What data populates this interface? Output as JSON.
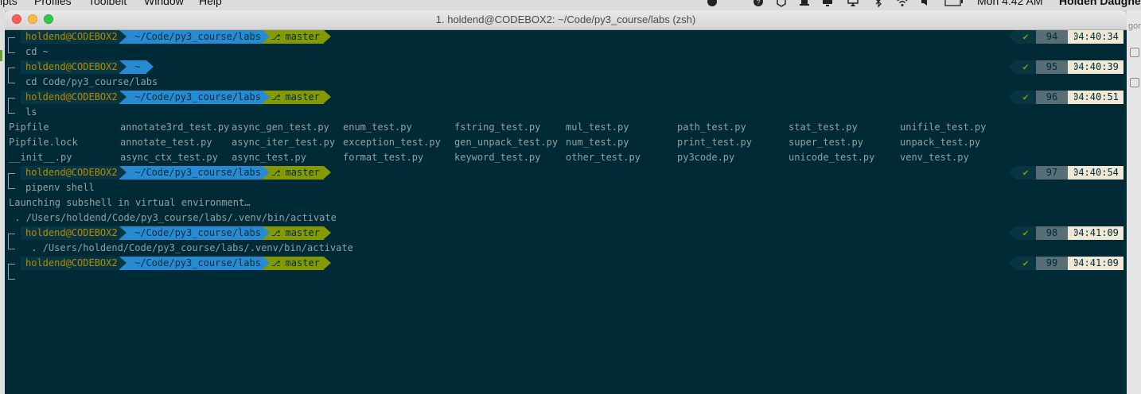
{
  "menubar": {
    "items": [
      "ipts",
      "Profiles",
      "Toolbelt",
      "Window",
      "Help"
    ],
    "clock": "Mon 4:42 AM",
    "user": "Holden Daughe"
  },
  "background": {
    "right_label": "gon"
  },
  "window": {
    "title": "1. holdend@CODEBOX2: ~/Code/py3_course/labs (zsh)"
  },
  "colors": {
    "base03": "#002b36",
    "base02": "#073642",
    "yellow": "#b58900",
    "blue": "#268bd2",
    "green": "#859900",
    "base01": "#586e75",
    "base2": "#eee8d5"
  },
  "prompts": [
    {
      "user": "holdend@CODEBOX2",
      "dir": "~/Code/py3_course/labs",
      "branch": "master ?",
      "check": "✔",
      "num": "94",
      "time": "04:40:34",
      "command": "cd ~"
    },
    {
      "user": "holdend@CODEBOX2",
      "dir": "~",
      "branch": "",
      "check": "✔",
      "num": "95",
      "time": "04:40:39",
      "command": "cd Code/py3_course/labs"
    },
    {
      "user": "holdend@CODEBOX2",
      "dir": "~/Code/py3_course/labs",
      "branch": "master ?",
      "check": "✔",
      "num": "96",
      "time": "04:40:51",
      "command": "ls"
    },
    {
      "user": "holdend@CODEBOX2",
      "dir": "~/Code/py3_course/labs",
      "branch": "master ?",
      "check": "✔",
      "num": "97",
      "time": "04:40:54",
      "command": "pipenv shell"
    },
    {
      "user": "holdend@CODEBOX2",
      "dir": "~/Code/py3_course/labs",
      "branch": "master ?",
      "check": "✔",
      "num": "98",
      "time": "04:41:09",
      "command": " . /Users/holdend/Code/py3_course/labs/.venv/bin/activate"
    },
    {
      "user": "holdend@CODEBOX2",
      "dir": "~/Code/py3_course/labs",
      "branch": "master ?",
      "check": "✔",
      "num": "99",
      "time": "04:41:09",
      "command": ""
    }
  ],
  "ls_output": [
    [
      "Pipfile",
      "annotate3rd_test.py",
      "async_gen_test.py",
      "enum_test.py",
      "fstring_test.py",
      "mul_test.py",
      "path_test.py",
      "stat_test.py",
      "unifile_test.py"
    ],
    [
      "Pipfile.lock",
      "annotate_test.py",
      "async_iter_test.py",
      "exception_test.py",
      "gen_unpack_test.py",
      "num_test.py",
      "print_test.py",
      "super_test.py",
      "unpack_test.py"
    ],
    [
      "__init__.py",
      "async_ctx_test.py",
      "async_test.py",
      "format_test.py",
      "keyword_test.py",
      "other_test.py",
      "py3code.py",
      "unicode_test.py",
      "venv_test.py"
    ]
  ],
  "pipenv_output": [
    "Launching subshell in virtual environment…",
    " . /Users/holdend/Code/py3_course/labs/.venv/bin/activate"
  ]
}
